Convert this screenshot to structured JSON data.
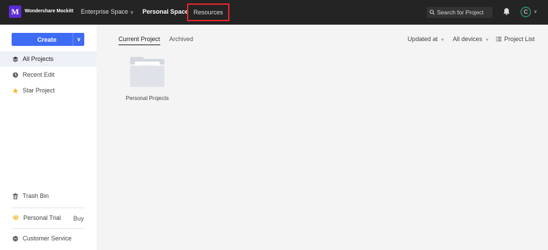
{
  "header": {
    "logo_letter": "M",
    "brand": "Wondershare Mockitt",
    "nav": {
      "enterprise": "Enterprise Space",
      "personal": "Personal Space",
      "resources": "Resources"
    },
    "search_placeholder": "Search for Project",
    "avatar_initial": "C"
  },
  "sidebar": {
    "create_label": "Create",
    "items": [
      {
        "label": "All Projects",
        "icon": "layers-icon"
      },
      {
        "label": "Recent Edit",
        "icon": "clock-icon"
      },
      {
        "label": "Star Project",
        "icon": "star-icon"
      }
    ],
    "trash": "Trash Bin",
    "trial": "Personal Trial",
    "buy": "Buy",
    "service": "Customer Service"
  },
  "main": {
    "tabs": [
      "Current Project",
      "Archived"
    ],
    "sort": "Updated at",
    "devices": "All devices",
    "view": "Project List",
    "folders": [
      {
        "label": "Personal Projects"
      }
    ]
  },
  "colors": {
    "topbar": "#242424",
    "accent": "#3e6cf5",
    "highlight": "#e4252c",
    "logo": "#5b2bd8",
    "avatar_ring": "#22c08a"
  }
}
